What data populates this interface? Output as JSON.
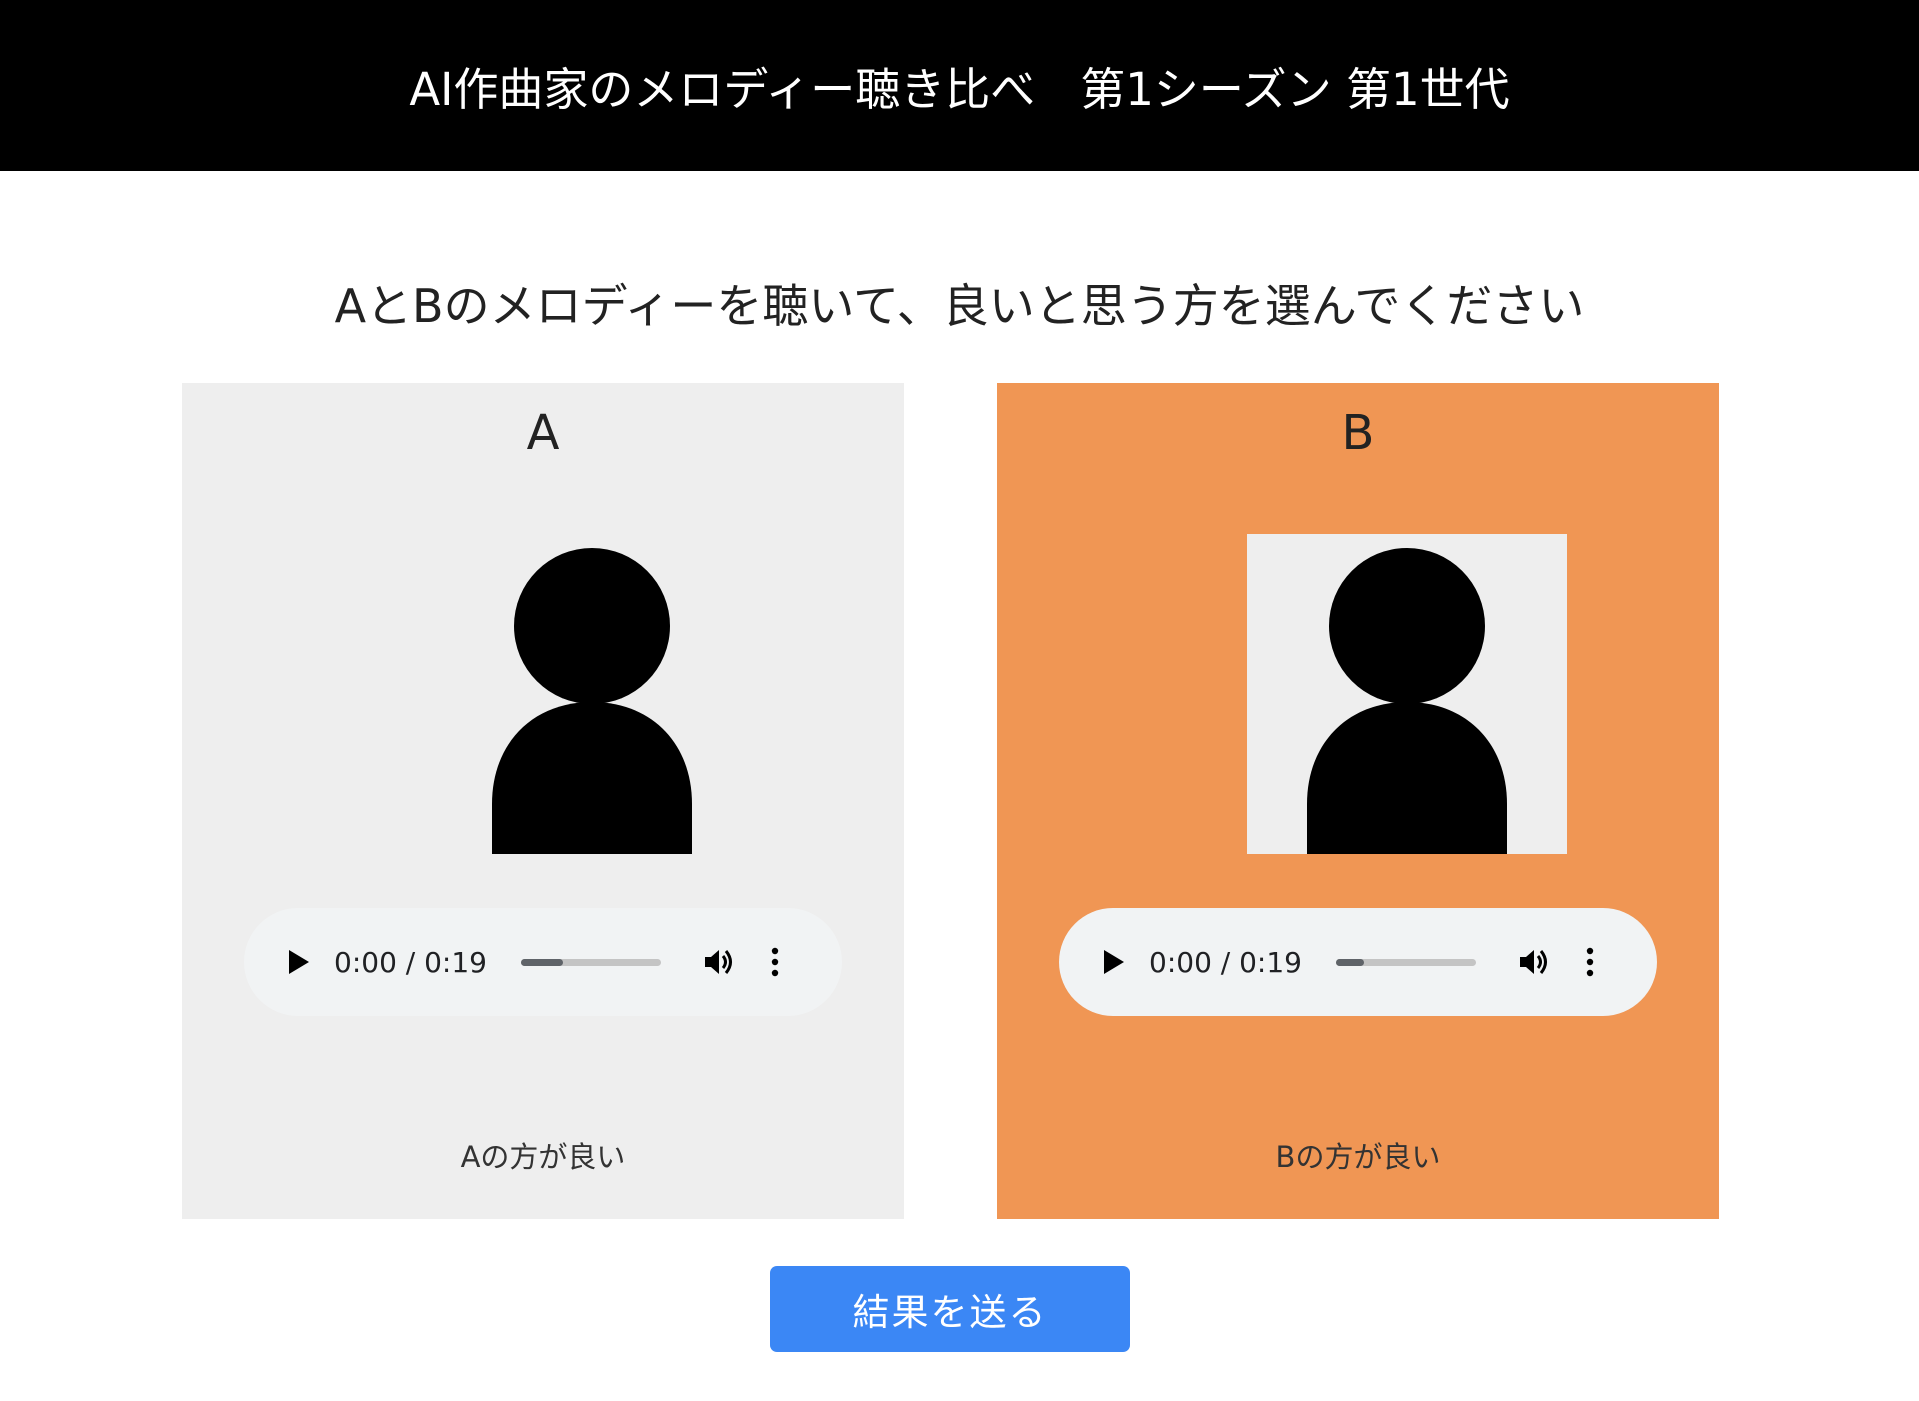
{
  "header": {
    "title": "AI作曲家のメロディー聴き比べ　第1シーズン 第1世代"
  },
  "instruction": "AとBのメロディーを聴いて、良いと思う方を選んでください",
  "colors": {
    "header_bg": "#000000",
    "card_a_bg": "#eeeeee",
    "card_b_bg_selected": "#f09654",
    "submit_bg": "#3b87f5"
  },
  "options": [
    {
      "label": "A",
      "avatar_icon": "person-silhouette-icon",
      "selected": false,
      "player": {
        "time": "0:00 / 0:19",
        "progress": 0.3
      },
      "choice_text": "Aの方が良い"
    },
    {
      "label": "B",
      "avatar_icon": "person-silhouette-icon",
      "selected": true,
      "player": {
        "time": "0:00 / 0:19",
        "progress": 0.2
      },
      "choice_text": "Bの方が良い"
    }
  ],
  "submit": {
    "label": "結果を送る"
  }
}
